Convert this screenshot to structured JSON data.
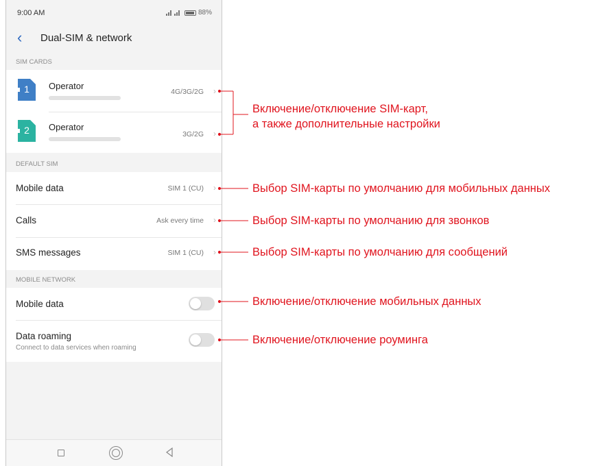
{
  "status_bar": {
    "time": "9:00 AM",
    "battery": "88%"
  },
  "header": {
    "title": "Dual-SIM & network"
  },
  "sim_cards": {
    "section_label": "SIM CARDS",
    "items": [
      {
        "number": "1",
        "name": "Operator",
        "network": "4G/3G/2G",
        "color": "#3f7fc6"
      },
      {
        "number": "2",
        "name": "Operator",
        "network": "3G/2G",
        "color": "#2bb3a1"
      }
    ]
  },
  "default_sim": {
    "section_label": "DEFAULT SIM",
    "items": [
      {
        "label": "Mobile data",
        "value": "SIM 1 (CU)"
      },
      {
        "label": "Calls",
        "value": "Ask every time"
      },
      {
        "label": "SMS messages",
        "value": "SIM 1 (CU)"
      }
    ]
  },
  "mobile_network": {
    "section_label": "MOBILE NETWORK",
    "items": [
      {
        "label": "Mobile data",
        "enabled": false
      },
      {
        "label": "Data roaming",
        "sublabel": "Connect to data services when roaming",
        "enabled": false
      }
    ]
  },
  "annotations": {
    "sim_toggle_line1": "Включение/отключение SIM-карт,",
    "sim_toggle_line2": "а также дополнительные настройки",
    "default_data": "Выбор SIM-карты по умолчанию для мобильных данных",
    "default_calls": "Выбор SIM-карты по умолчанию для звонков",
    "default_sms": "Выбор SIM-карты по умолчанию для сообщений",
    "mobile_data_toggle": "Включение/отключение мобильных данных",
    "roaming_toggle": "Включение/отключение роуминга"
  },
  "colors": {
    "accent": "#2f6ac1",
    "annotation": "#e0141e"
  }
}
